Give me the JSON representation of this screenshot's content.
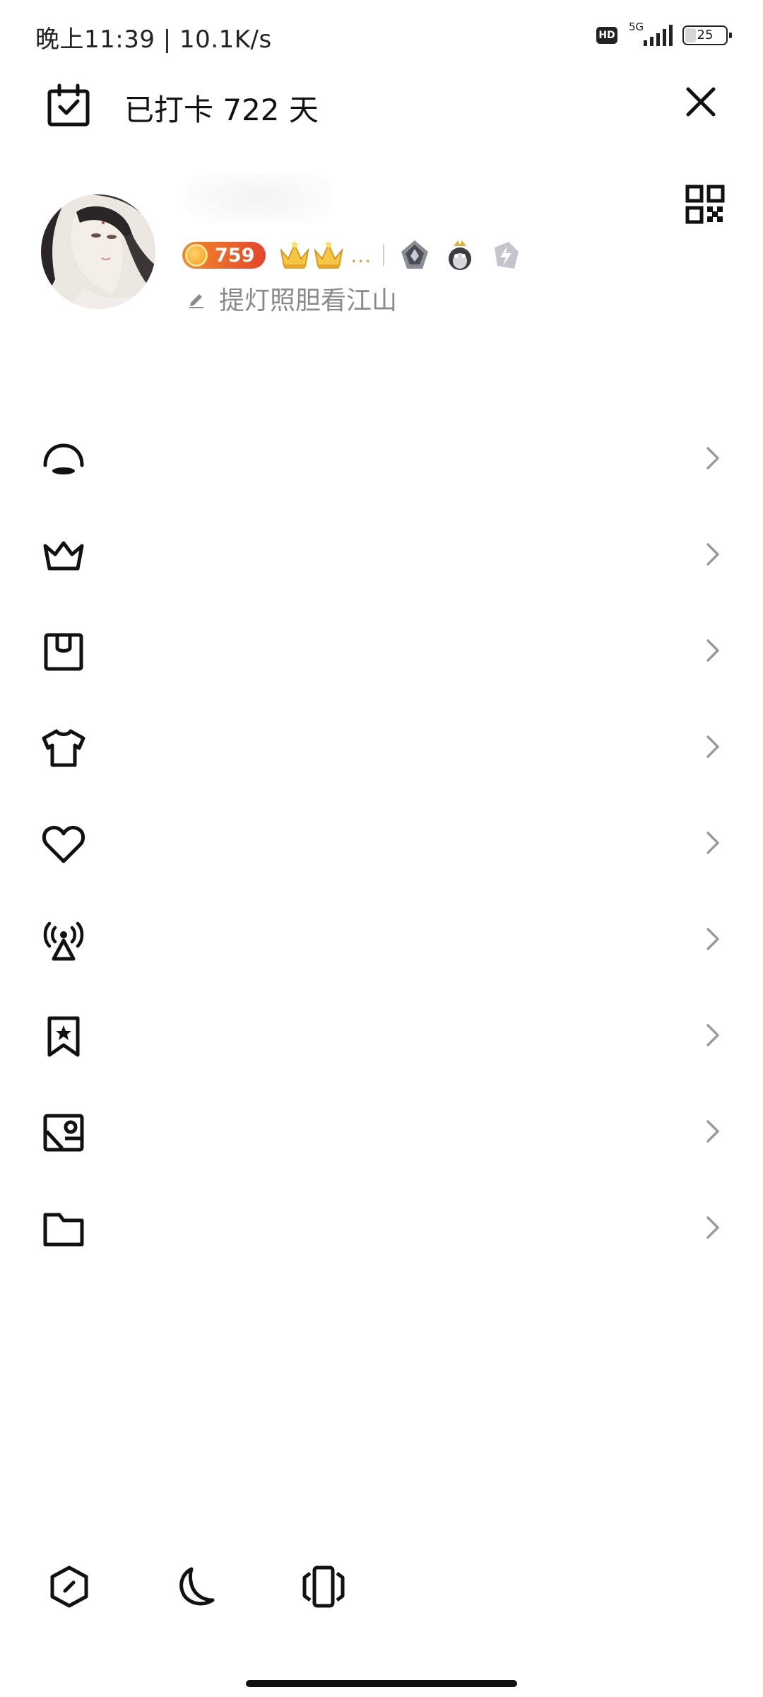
{
  "status_bar": {
    "time": "晚上11:39 | 10.1K/s",
    "hd_label": "HD",
    "network": "5G",
    "battery": "25",
    "battery_level": 0.25
  },
  "header": {
    "checkin_text": "已打卡 722 天",
    "checkin_icon": "calendar-check-icon",
    "close_icon": "close-icon"
  },
  "profile": {
    "level": "759",
    "more": "...",
    "signature": "提灯照胆看江山",
    "qr_icon": "qr-code-icon"
  },
  "menu": {
    "items": [
      {
        "icon": "semicircle-icon",
        "label": ""
      },
      {
        "icon": "crown-icon",
        "label": ""
      },
      {
        "icon": "wallet-icon",
        "label": ""
      },
      {
        "icon": "tshirt-icon",
        "label": ""
      },
      {
        "icon": "heart-icon",
        "label": ""
      },
      {
        "icon": "broadcast-icon",
        "label": ""
      },
      {
        "icon": "bookmark-star-icon",
        "label": ""
      },
      {
        "icon": "photo-icon",
        "label": ""
      },
      {
        "icon": "folder-icon",
        "label": ""
      }
    ]
  },
  "bottom_bar": {
    "buttons": [
      "settings-hex-icon",
      "moon-icon",
      "phone-vibrate-icon"
    ]
  },
  "colors": {
    "level_badge_start": "#f28a2a",
    "level_badge_end": "#e4452a",
    "signature_text": "#8a8a8a",
    "chevron": "#9a9a9a"
  }
}
